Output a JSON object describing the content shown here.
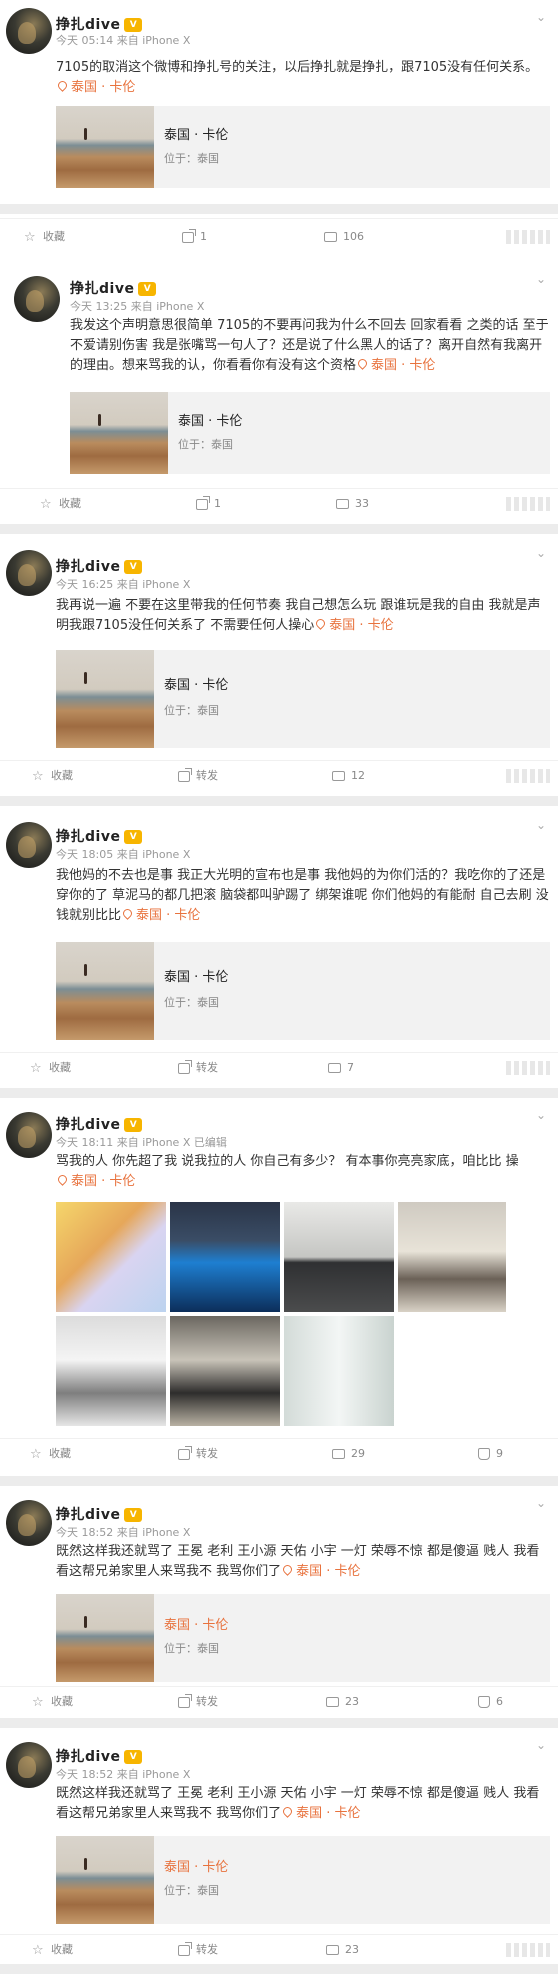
{
  "ui": {
    "fav": "收藏",
    "repost": "转发",
    "location": "泰国 · 卡伦",
    "place_card_title": "泰国 · 卡伦",
    "place_card_sub": "位于：泰国",
    "vip_badge": "V"
  },
  "posts": [
    {
      "user": "挣扎dive",
      "meta": "今天 05:14 来自 iPhone X",
      "text": "7105的取消这个微博和挣扎号的关注，以后挣扎就是挣扎，跟7105没有任何关系。",
      "repost": "1",
      "comments": "106"
    },
    {
      "user": "挣扎dive",
      "meta": "今天 13:25 来自 iPhone X",
      "text": "我发这个声明意思很简单 7105的不要再问我为什么不回去 回家看看 之类的话 至于 不爱请别伤害 我是张嘴骂一句人了？还是说了什么黑人的话了？离开自然有我离开的理由。想来骂我的认，你看看你有没有这个资格",
      "repost": "1",
      "comments": "33"
    },
    {
      "user": "挣扎dive",
      "meta": "今天 16:25 来自 iPhone X",
      "text": "我再说一遍 不要在这里带我的任何节奏 我自己想怎么玩 跟谁玩是我的自由 我就是声明我跟7105没任何关系了 不需要任何人操心",
      "comments": "12"
    },
    {
      "user": "挣扎dive",
      "meta": "今天 18:05 来自 iPhone X",
      "text": "我他妈的不去也是事 我正大光明的宣布也是事 我他妈的为你们活的？我吃你的了还是穿你的了 草泥马的都几把滚 脑袋都叫驴踢了 绑架谁呢 你们他妈的有能耐 自己去刷 没钱就别比比",
      "comments": "7"
    },
    {
      "user": "挣扎dive",
      "meta": "今天 18:11 来自 iPhone X 已编辑",
      "text": "骂我的人 你先超了我 说我拉的人 你自己有多少？ 有本事你亮亮家底，咱比比 操",
      "comments": "29",
      "likes": "9"
    },
    {
      "user": "挣扎dive",
      "meta": "今天 18:52 来自 iPhone X",
      "text": "既然这样我还就骂了 王冕 老利 王小源 天佑 小宇 一灯 荣辱不惊 都是傻逼 贱人 我看看这帮兄弟家里人来骂我不 我骂你们了",
      "comments": "23",
      "likes": "6"
    },
    {
      "user": "挣扎dive",
      "meta": "今天 18:52 来自 iPhone X",
      "text": "既然这样我还就骂了 王冕 老利 王小源 天佑 小宇 一灯 荣辱不惊 都是傻逼 贱人 我看看这帮兄弟家里人来骂我不 我骂你们了",
      "comments": "23"
    }
  ]
}
